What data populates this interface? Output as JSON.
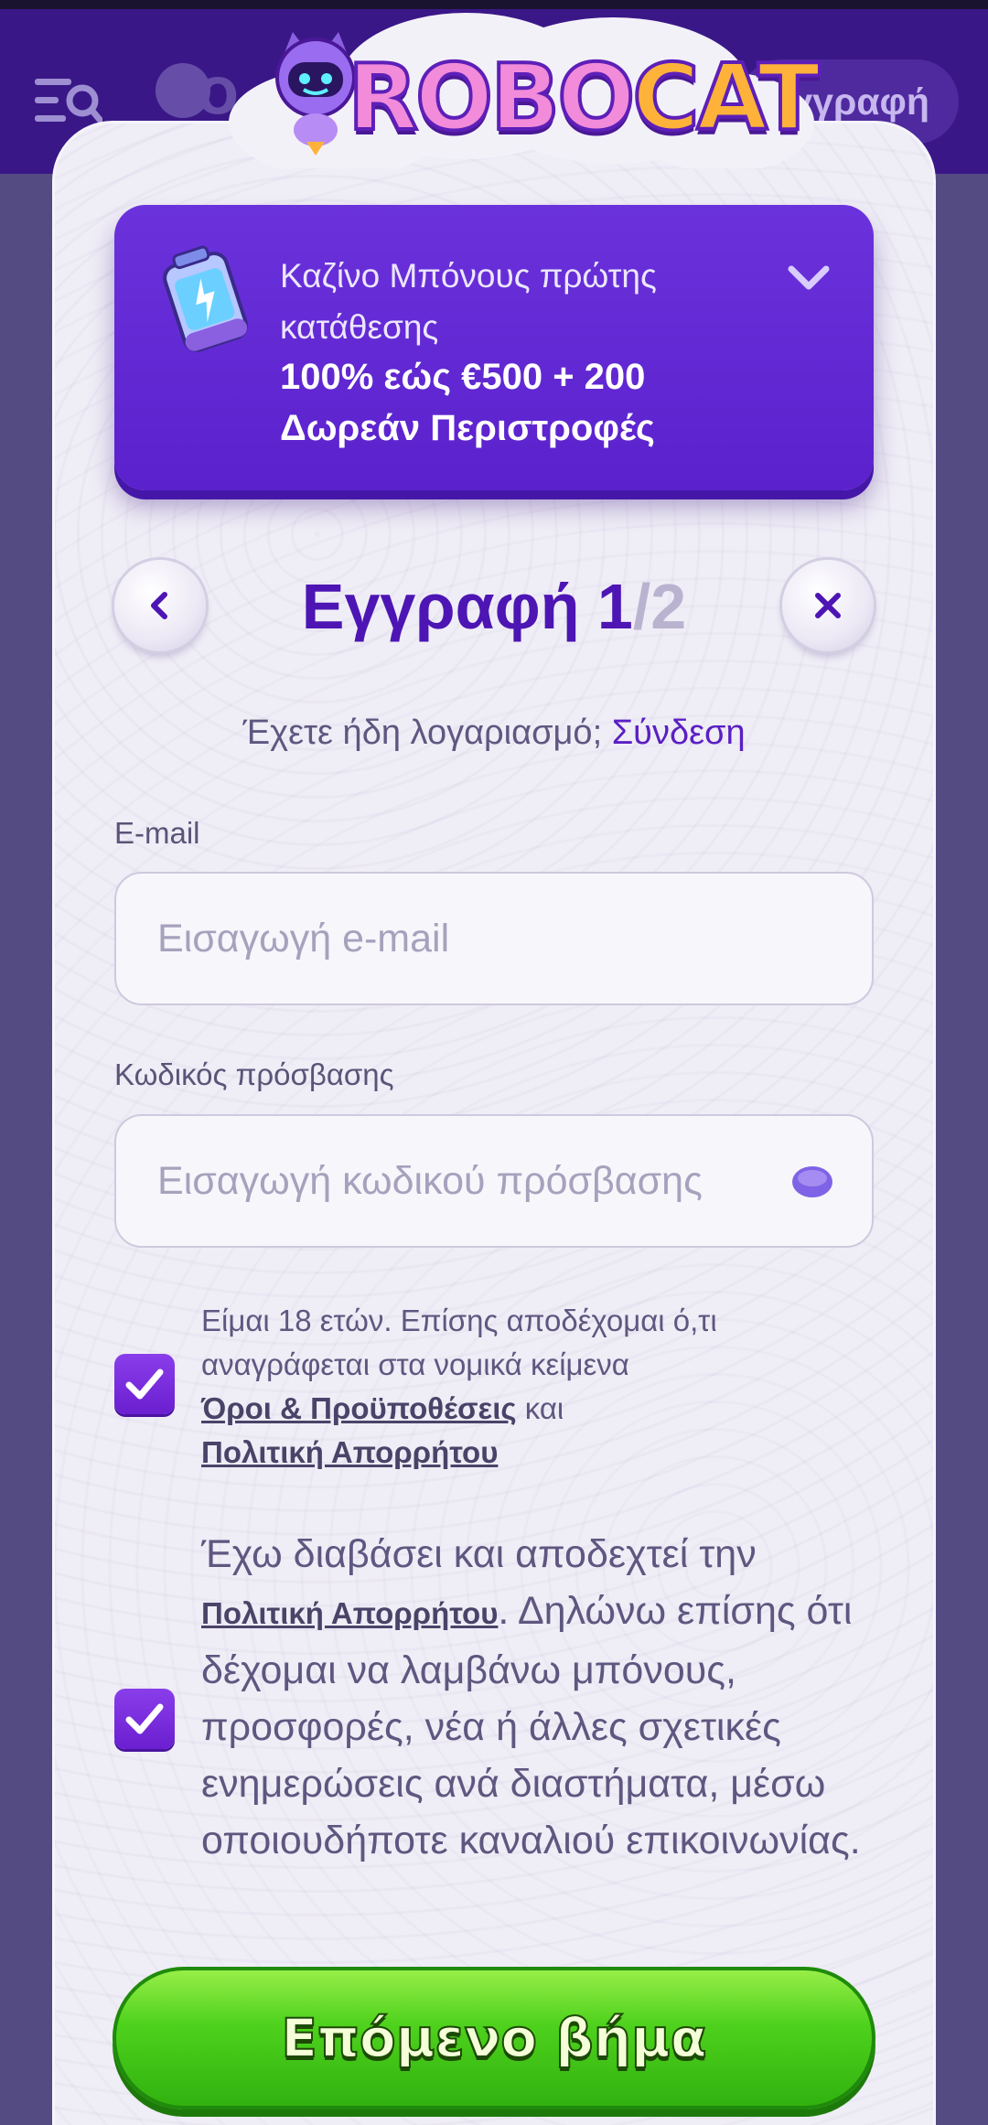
{
  "background_header": {
    "logo_text": "ORO",
    "register_label": "Εγγραφή"
  },
  "logo": {
    "part1": "ROBO",
    "part2": "CAT"
  },
  "bonus": {
    "subtitle": "Καζίνο Μπόνους πρώτης κατάθεσης",
    "title": "100% εώς €500 + 200 Δωρεάν Περιστροφές"
  },
  "step": {
    "title": "Εγγραφή 1",
    "total": "/2"
  },
  "login_prompt": {
    "text": "Έχετε ήδη λογαριασμό;",
    "link": "Σύνδεση"
  },
  "email": {
    "label": "E-mail",
    "placeholder": "Εισαγωγή e-mail"
  },
  "password": {
    "label": "Κωδικός πρόσβασης",
    "placeholder": "Εισαγωγή κωδικού πρόσβασης"
  },
  "consent_terms": {
    "checked": true,
    "text": "Είμαι 18 ετών. Επίσης αποδέχομαι ό,τι αναγράφεται στα νομικά κείμενα",
    "terms_link": "Όροι & Προϋποθέσεις",
    "and": "και",
    "privacy_link": "Πολιτική Απορρήτου"
  },
  "consent_marketing": {
    "checked": true,
    "text_before": "Έχω διαβάσει και αποδεχτεί την",
    "privacy_link": "Πολιτική Απορρήτου",
    "text_after": ". Δηλώνω επίσης ότι δέχομαι να λαμβάνω μπόνους, προσφορές, νέα ή άλλες σχετικές ενημερώσεις ανά διαστήματα, μέσω οποιουδήποτε καναλιού επικοινωνίας."
  },
  "next_button": {
    "label": "Επόμενο βήμα"
  },
  "colors": {
    "primary": "#5a21cc",
    "accent": "#4d15b3",
    "cta": "#4fd21d"
  },
  "icons": [
    "menu-search-icon",
    "robot-logo-icon",
    "battery-bonus-icon",
    "chevron-down-icon",
    "chevron-left-icon",
    "close-icon",
    "eye-icon",
    "checkmark-icon"
  ]
}
